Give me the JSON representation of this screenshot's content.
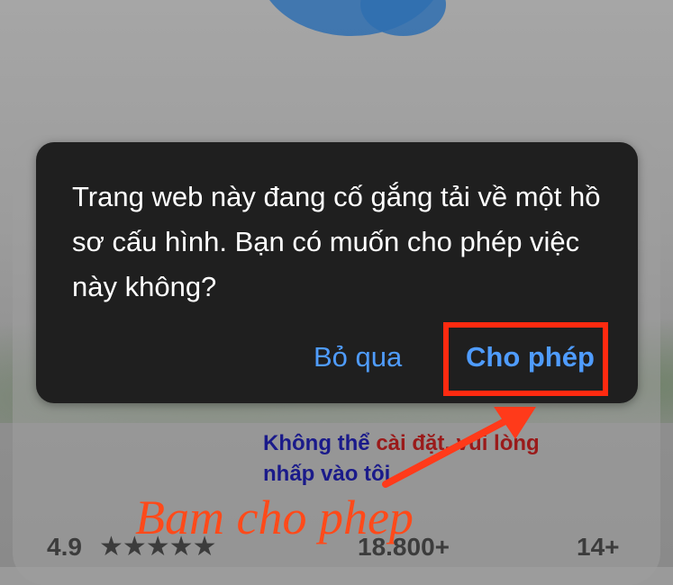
{
  "dialog": {
    "message": "Trang web này đang cố gắng tải về một hồ sơ cấu hình. Bạn có muốn cho phép việc này không?",
    "buttons": {
      "skip": "Bỏ qua",
      "allow": "Cho phép"
    }
  },
  "note": {
    "part1": "Không thể ",
    "part2": "cài đặt, vui lòng",
    "line2": "nhấp vào tôi"
  },
  "annotation": "Bam cho phep",
  "app_stats": {
    "rating": "4.9",
    "stars": "★★★★★",
    "reviews": "18.800+",
    "age": "14+"
  },
  "colors": {
    "dialog_bg": "#1f1f1f",
    "button_blue": "#4f9cff",
    "highlight_red": "#ff2a10",
    "annotation_orange": "#ff4a1a"
  }
}
